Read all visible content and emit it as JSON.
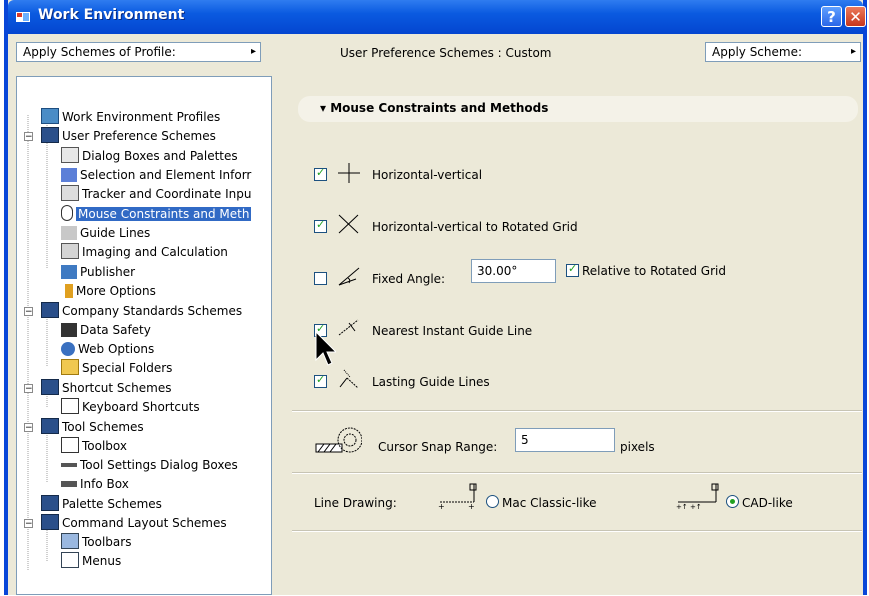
{
  "window": {
    "title": "Work Environment",
    "help_label": "?",
    "close_label": "✕"
  },
  "topbar": {
    "profile_dropdown": "Apply Schemes of Profile:",
    "preference_label": "User Preference Schemes : Custom",
    "apply_dropdown": "Apply Scheme:"
  },
  "tree": {
    "root": "Work Environment Profiles",
    "user_pref": "User Preference Schemes",
    "dialog_boxes": "Dialog Boxes and Palettes",
    "selection": "Selection and Element Inforr",
    "tracker": "Tracker and Coordinate Inpu",
    "mouse": "Mouse Constraints and Meth",
    "guide_lines": "Guide Lines",
    "imaging": "Imaging and Calculation",
    "publisher": "Publisher",
    "more_options": "More Options",
    "company": "Company Standards Schemes",
    "data_safety": "Data Safety",
    "web_options": "Web Options",
    "special_folders": "Special Folders",
    "shortcut": "Shortcut Schemes",
    "keyboard": "Keyboard Shortcuts",
    "tool_schemes": "Tool Schemes",
    "toolbox": "Toolbox",
    "tool_settings": "Tool Settings Dialog Boxes",
    "info_box": "Info Box",
    "palette": "Palette Schemes",
    "command": "Command Layout Schemes",
    "toolbars": "Toolbars",
    "menus": "Menus"
  },
  "panel": {
    "section_title": "Mouse Constraints and Methods",
    "hv": {
      "label": "Horizontal-vertical",
      "checked": true
    },
    "hv_rot": {
      "label": "Horizontal-vertical to Rotated Grid",
      "checked": true
    },
    "fixed": {
      "label": "Fixed Angle:",
      "value": "30.00°",
      "checked": false
    },
    "rel_rot": {
      "label": "Relative to Rotated Grid",
      "checked": true
    },
    "nearest": {
      "label": "Nearest Instant Guide Line",
      "checked": true
    },
    "lasting": {
      "label": "Lasting Guide Lines",
      "checked": true
    },
    "snap": {
      "label": "Cursor Snap Range:",
      "value": "5",
      "unit": "pixels"
    },
    "line_drawing": {
      "label": "Line Drawing:",
      "mac": "Mac Classic-like",
      "cad": "CAD-like",
      "selected": "CAD-like"
    }
  },
  "colors": {
    "titlebar": "#0a5ae0",
    "selection": "#316ac5",
    "dialog_bg": "#ece9d8",
    "check": "#21a121"
  }
}
